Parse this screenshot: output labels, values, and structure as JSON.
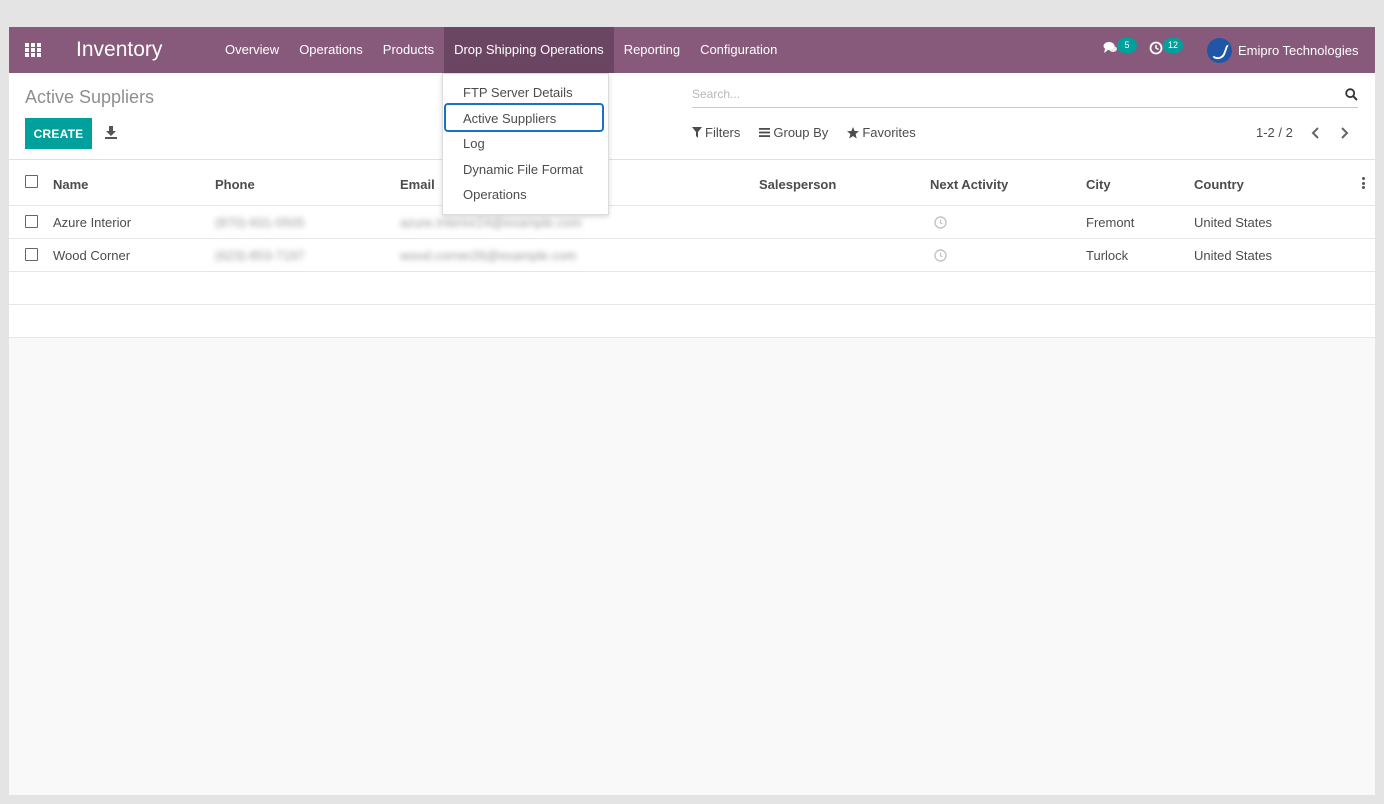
{
  "navbar": {
    "app_title": "Inventory",
    "menu": [
      "Overview",
      "Operations",
      "Products",
      "Drop Shipping Operations",
      "Reporting",
      "Configuration"
    ],
    "messages_count": "5",
    "activities_count": "12",
    "user_name": "Emipro Technologies",
    "color": "#875a7b"
  },
  "dropdown": {
    "items": [
      "FTP Server Details",
      "Active Suppliers",
      "Log",
      "Dynamic File Format",
      "Operations"
    ],
    "highlighted": "Active Suppliers"
  },
  "control": {
    "page_title": "Active Suppliers",
    "create_label": "CREATE",
    "search_placeholder": "Search...",
    "filters_label": "Filters",
    "groupby_label": "Group By",
    "favorites_label": "Favorites",
    "pager": "1-2 / 2",
    "accent": "#00a09d"
  },
  "table": {
    "columns": [
      "Name",
      "Phone",
      "Email",
      "Salesperson",
      "Next Activity",
      "City",
      "Country"
    ],
    "rows": [
      {
        "name": "Azure Interior",
        "phone": "(870)-931-0505",
        "email": "azure.Interior24@example.com",
        "salesperson": "",
        "city": "Fremont",
        "country": "United States"
      },
      {
        "name": "Wood Corner",
        "phone": "(623)-853-7197",
        "email": "wood.corner26@example.com",
        "salesperson": "",
        "city": "Turlock",
        "country": "United States"
      }
    ]
  }
}
